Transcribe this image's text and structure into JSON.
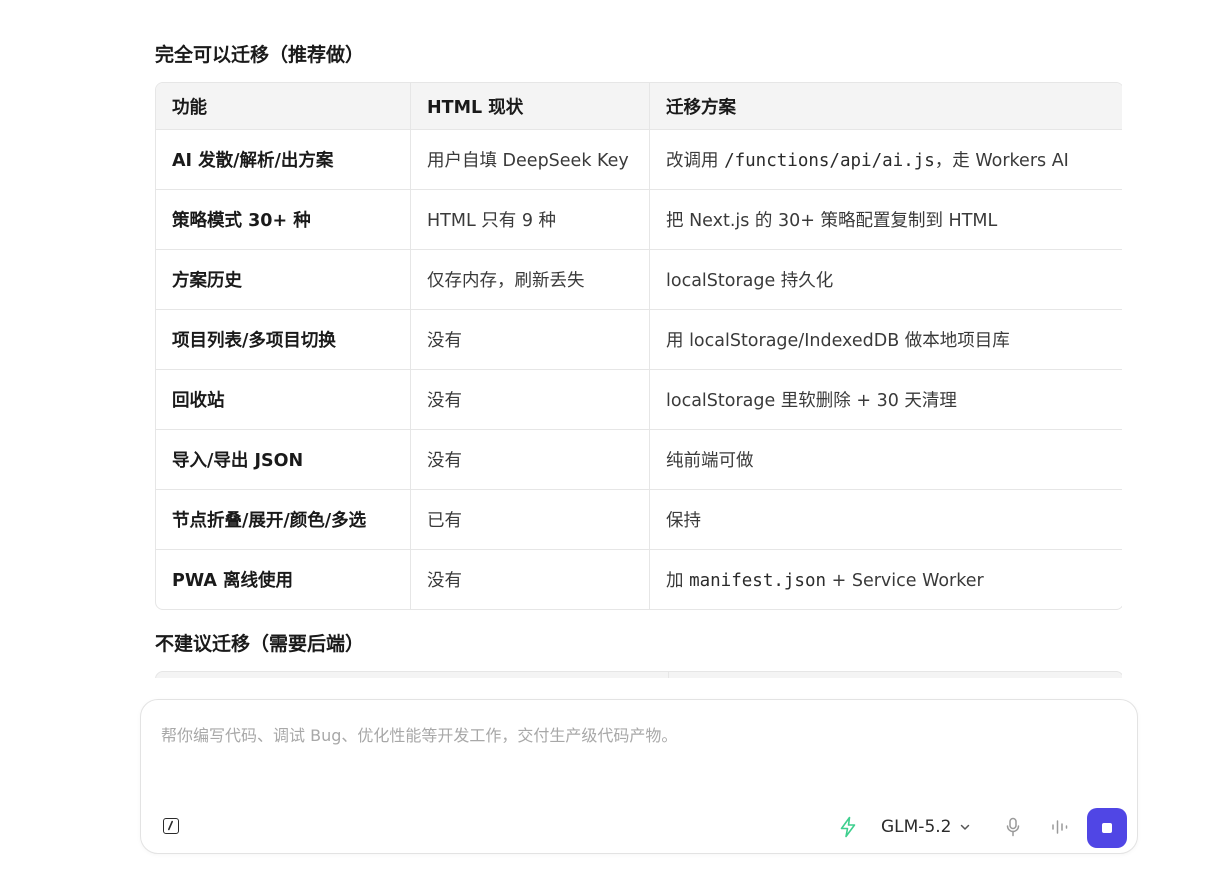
{
  "section1": {
    "title": "完全可以迁移（推荐做）",
    "headers": [
      "功能",
      "HTML 现状",
      "迁移方案"
    ],
    "rows": [
      {
        "feature": "AI 发散/解析/出方案",
        "status": "用户自填 DeepSeek Key",
        "plan_before": "改调用 ",
        "plan_code": "/functions/api/ai.js",
        "plan_after": "，走 Workers AI"
      },
      {
        "feature": "策略模式 30+ 种",
        "status": "HTML 只有 9 种",
        "plan_before": "把 Next.js 的 30+ 策略配置复制到 HTML",
        "plan_code": "",
        "plan_after": ""
      },
      {
        "feature": "方案历史",
        "status": "仅存内存，刷新丢失",
        "plan_before": "localStorage 持久化",
        "plan_code": "",
        "plan_after": ""
      },
      {
        "feature": "项目列表/多项目切换",
        "status": "没有",
        "plan_before": "用 localStorage/IndexedDB 做本地项目库",
        "plan_code": "",
        "plan_after": ""
      },
      {
        "feature": "回收站",
        "status": "没有",
        "plan_before": "localStorage 里软删除 + 30 天清理",
        "plan_code": "",
        "plan_after": ""
      },
      {
        "feature": "导入/导出 JSON",
        "status": "没有",
        "plan_before": "纯前端可做",
        "plan_code": "",
        "plan_after": ""
      },
      {
        "feature": "节点折叠/展开/颜色/多选",
        "status": "已有",
        "plan_before": "保持",
        "plan_code": "",
        "plan_after": ""
      },
      {
        "feature": "PWA 离线使用",
        "status": "没有",
        "plan_before": "加 ",
        "plan_code": "manifest.json",
        "plan_after": " + Service Worker"
      }
    ]
  },
  "section2": {
    "title": "不建议迁移（需要后端）"
  },
  "composer": {
    "placeholder": "帮你编写代码、调试 Bug、优化性能等开发工作，交付生产级代码产物。",
    "model_label": "GLM-5.2"
  },
  "icons": {
    "slash": "slash-command-icon",
    "bolt": "bolt-icon",
    "chevron": "chevron-down-icon",
    "mic": "microphone-icon",
    "wave": "audio-wave-icon",
    "stop": "stop-icon"
  },
  "colors": {
    "accent": "#5046e5",
    "bolt": "#3ecf8e",
    "header_bg": "#f4f4f4"
  }
}
